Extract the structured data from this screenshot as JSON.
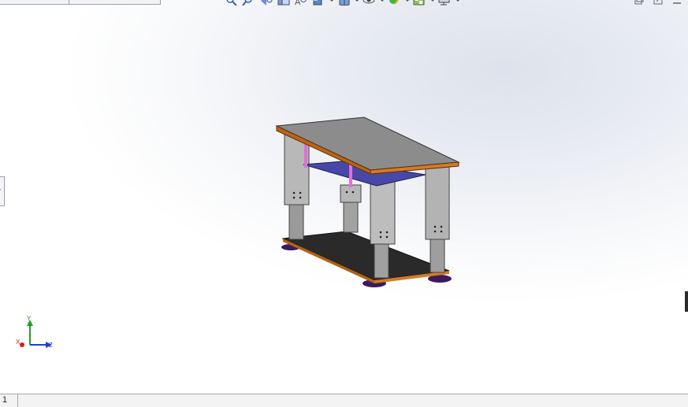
{
  "viewport": {
    "top_left_field": "",
    "heads_up_toolbar": [
      {
        "icon": "zoom-to-fit-icon"
      },
      {
        "icon": "zoom-to-area-icon"
      },
      {
        "icon": "previous-view-icon"
      },
      {
        "icon": "section-view-icon"
      },
      {
        "icon": "dynamic-annotation-icon"
      },
      {
        "icon": "view-orientation-icon"
      },
      {
        "icon": "display-style-icon"
      },
      {
        "icon": "hide-show-items-icon"
      },
      {
        "icon": "edit-appearance-icon"
      },
      {
        "icon": "apply-scene-icon"
      },
      {
        "icon": "view-settings-icon"
      }
    ],
    "window_controls": [
      "restore-icon",
      "maximize-icon",
      "minimize-icon"
    ],
    "triad": {
      "x_label": "X",
      "y_label": "Y",
      "z_label": "Z"
    },
    "model": "workbench-assembly"
  },
  "colors": {
    "table_top": "#8c8c8c",
    "wood_edge": "#c46a1a",
    "shelf": "#4848a8",
    "legs": "#b5b5b5",
    "base_plate": "#2a2a2a",
    "feet": "#3c1a5c",
    "pink_spacer": "#e070d8",
    "axis_x": "#d02020",
    "axis_y": "#20a020",
    "axis_z": "#2040d0"
  },
  "status_bar": {
    "cell": "1"
  }
}
